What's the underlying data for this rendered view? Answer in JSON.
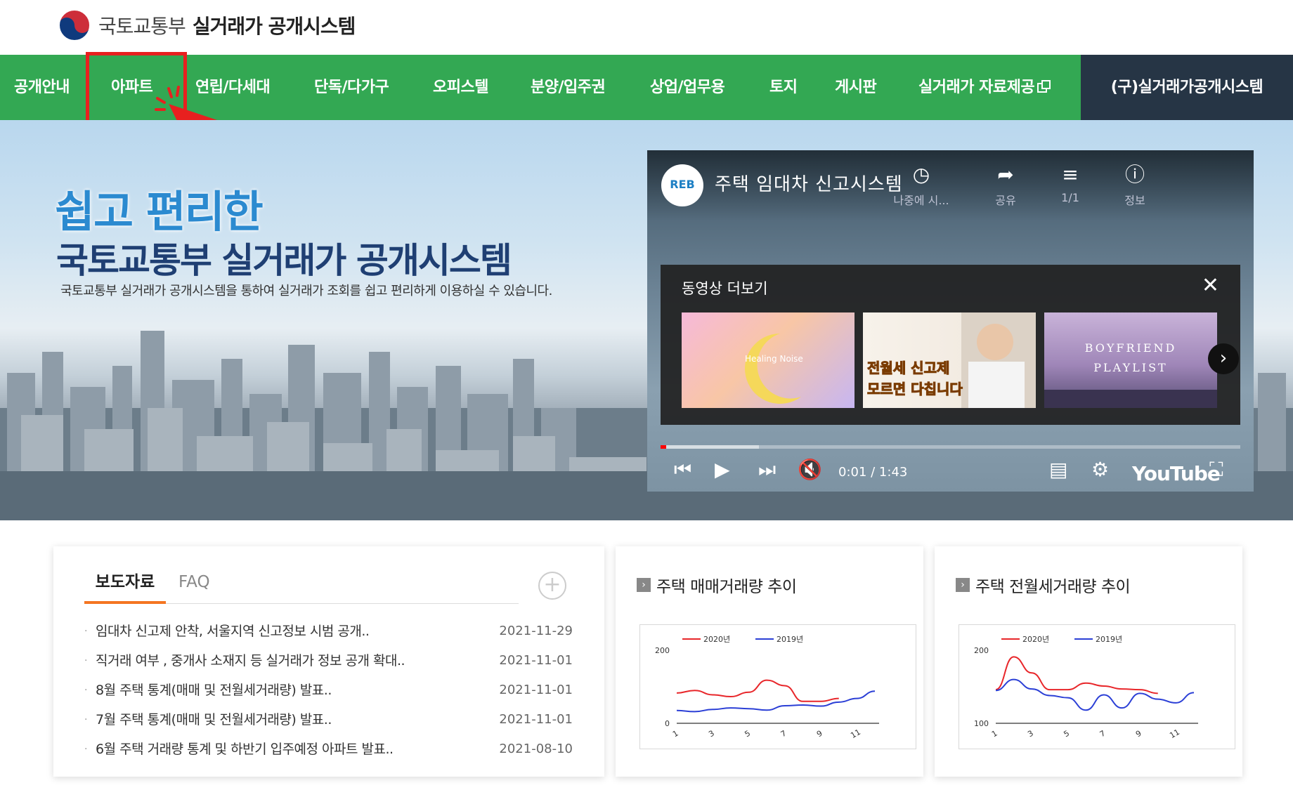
{
  "header": {
    "ministry": "국토교통부",
    "system_name": "실거래가 공개시스템"
  },
  "nav": {
    "items": [
      "공개안내",
      "아파트",
      "연립/다세대",
      "단독/다가구",
      "오피스텔",
      "분양/입주권",
      "상업/업무용",
      "토지",
      "게시판",
      "실거래가 자료제공"
    ],
    "old_system": "(구)실거래가공개시스템"
  },
  "hero": {
    "title_line1": "쉽고 편리한",
    "title_line2": "국토교통부 실거래가 공개시스템",
    "description": "국토교통부 실거래가 공개시스템을 통하여 실거래가 조회를 쉽고 편리하게 이용하실 수 있습니다."
  },
  "video": {
    "channel_logo": "REB",
    "title": "주택 임대차 신고시스템",
    "top_actions": [
      "나중에 시...",
      "공유",
      "1/1",
      "정보"
    ],
    "more_videos_title": "동영상 더보기",
    "thumb1_text": "Healing Noise",
    "thumb2_caption_line1": "전월세 신고제",
    "thumb2_caption_line2": "모르면 다칩니다",
    "thumb3_text_line1": "BOYFRIEND",
    "thumb3_text_line2": "PLAYLIST",
    "time": "0:01 / 1:43",
    "brand": "YouTube",
    "progress": 0.01,
    "buffered": 0.17
  },
  "news": {
    "tabs": [
      "보도자료",
      "FAQ"
    ],
    "items": [
      {
        "title": "임대차 신고제 안착, 서울지역 신고정보 시범 공개..",
        "date": "2021-11-29"
      },
      {
        "title": "직거래 여부 , 중개사 소재지 등 실거래가 정보 공개 확대..",
        "date": "2021-11-01"
      },
      {
        "title": "8월 주택 통계(매매 및 전월세거래량) 발표..",
        "date": "2021-11-01"
      },
      {
        "title": "7월 주택 통계(매매 및 전월세거래량) 발표..",
        "date": "2021-11-01"
      },
      {
        "title": "6월 주택 거래량 통계 및 하반기 입주예정 아파트 발표..",
        "date": "2021-08-10"
      }
    ]
  },
  "chart_data": [
    {
      "type": "line",
      "title": "주택 매매거래량 추이",
      "x": [
        1,
        2,
        3,
        4,
        5,
        6,
        7,
        8,
        9,
        10,
        11,
        12
      ],
      "x_tick_labels": [
        "1",
        "3",
        "5",
        "7",
        "9",
        "11"
      ],
      "ylim": [
        0,
        200
      ],
      "y_ticks": [
        0,
        200
      ],
      "legend_position": "top-left",
      "series": [
        {
          "name": "2020년",
          "color": "#e8262a",
          "values": [
            83,
            90,
            78,
            73,
            85,
            118,
            103,
            60,
            60,
            68
          ]
        },
        {
          "name": "2019년",
          "color": "#2b3fd6",
          "values": [
            35,
            32,
            38,
            42,
            40,
            36,
            48,
            50,
            47,
            58,
            68,
            88
          ]
        }
      ]
    },
    {
      "type": "line",
      "title": "주택 전월세거래량 추이",
      "x": [
        1,
        2,
        3,
        4,
        5,
        6,
        7,
        8,
        9,
        10,
        11,
        12
      ],
      "x_tick_labels": [
        "1",
        "3",
        "5",
        "7",
        "9",
        "11"
      ],
      "ylim": [
        100,
        200
      ],
      "y_ticks": [
        100,
        200
      ],
      "legend_position": "top-left",
      "series": [
        {
          "name": "2020년",
          "color": "#e8262a",
          "values": [
            146,
            191,
            169,
            146,
            146,
            155,
            151,
            147,
            146,
            141
          ]
        },
        {
          "name": "2019년",
          "color": "#2b3fd6",
          "values": [
            145,
            160,
            147,
            138,
            135,
            118,
            139,
            121,
            141,
            133,
            128,
            142
          ]
        }
      ]
    }
  ]
}
